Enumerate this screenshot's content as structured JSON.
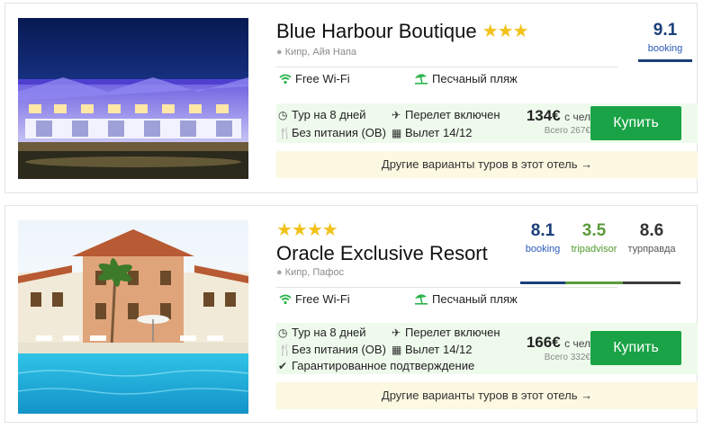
{
  "hotels": [
    {
      "name": "Blue Harbour Boutique",
      "stars": "★★★",
      "location": "Кипр, Айя Напа",
      "amenities": [
        "Free Wi-Fi",
        "Песчаный пляж"
      ],
      "tour_nights": "Тур на 8 дней",
      "meal": "Без питания (OB)",
      "flight": "Перелет включен",
      "departure": "Вылет 14/12",
      "price": "134€",
      "price_unit": "с чел",
      "total": "Всего 267€",
      "buy_label": "Купить",
      "more_label": "Другие варианты туров в этот отель →",
      "ratings": [
        {
          "score": "9.1",
          "source": "booking",
          "color": "#1a3f7a",
          "label_color": "#2a5ab7"
        }
      ]
    },
    {
      "name": "Oracle Exclusive Resort",
      "stars": "★★★★",
      "location": "Кипр, Пафос",
      "amenities": [
        "Free Wi-Fi",
        "Песчаный пляж"
      ],
      "tour_nights": "Тур на 8 дней",
      "meal": "Без питания (OB)",
      "flight": "Перелет включен",
      "departure": "Вылет 14/12",
      "guarantee": "Гарантированное подтверждение",
      "price": "166€",
      "price_unit": "с чел",
      "total": "Всего 332€",
      "buy_label": "Купить",
      "more_label": "Другие варианты туров в этот отель →",
      "ratings": [
        {
          "score": "8.1",
          "source": "booking",
          "color": "#1a3f7a",
          "label_color": "#2a5ab7"
        },
        {
          "score": "3.5",
          "source": "tripadvisor",
          "color": "#5b9a3a",
          "label_color": "#4f9a2d"
        },
        {
          "score": "8.6",
          "source": "турправда",
          "color": "#3a3a3a",
          "label_color": "#555555"
        }
      ]
    }
  ],
  "colors": {
    "accent_green": "#1aa346",
    "offer_bg": "#eefbec",
    "more_bg": "#fcf8e1",
    "star": "#f2c21b"
  },
  "icons": [
    "map-pin-icon",
    "wifi-icon",
    "beach-umbrella-icon",
    "clock-icon",
    "plane-icon",
    "fork-knife-icon",
    "calendar-icon",
    "check-circle-icon"
  ]
}
